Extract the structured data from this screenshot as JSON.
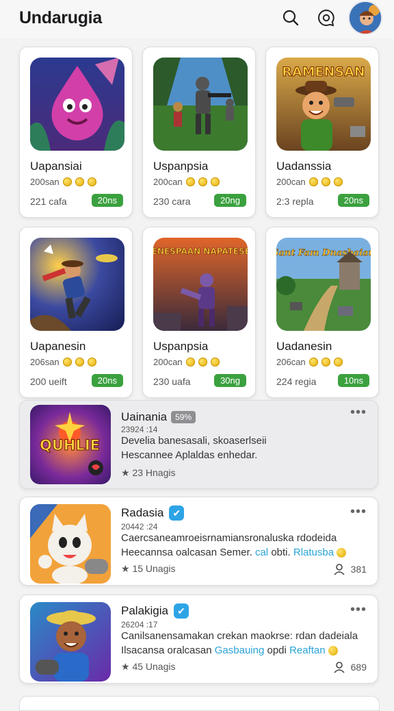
{
  "app": {
    "title": "Undarugia"
  },
  "cards": [
    {
      "title": "Uapansiai",
      "sub": "200san",
      "count": "221 cafa",
      "badge": "20ns",
      "art_text": ""
    },
    {
      "title": "Uspanpsia",
      "sub": "200can",
      "count": "230 cara",
      "badge": "20ng",
      "art_text": ""
    },
    {
      "title": "Uadanssia",
      "sub": "200can",
      "count": "2:3 repla",
      "badge": "20ns",
      "art_text": "RAMENSAN"
    },
    {
      "title": "Uapanesin",
      "sub": "206san",
      "count": "200 ueift",
      "badge": "20ns",
      "art_text": ""
    },
    {
      "title": "Uspanpsia",
      "sub": "200can",
      "count": "230 uafa",
      "badge": "30ng",
      "art_text": "GENESPAAN NAPATESEE"
    },
    {
      "title": "Uadanesin",
      "sub": "206can",
      "count": "224 regia",
      "badge": "10ns",
      "art_text": "Sant Fam Dnasbaian"
    }
  ],
  "posts": [
    {
      "title": "Uainania",
      "tag": "59%",
      "date": "23924 :14",
      "desc_line1": "Develia banesasali, skoaserlseii",
      "desc_line2": "Hescannee Aplaldas enhedar.",
      "stars": "23 Hnagis",
      "followers": "",
      "art_text": "QUHLIE"
    },
    {
      "title": "Radasia",
      "tag": "",
      "date": "20442 :24",
      "desc_line1": "Caercsaneamroeisrnamiansronaluska rdodeida",
      "desc_line2_pre": "Heecannsa oalcasan Semer.",
      "link1": "cal",
      "mid": "obti.",
      "link2": "Rlatusba",
      "stars": "15 Unagis",
      "followers": "381",
      "art_text": ""
    },
    {
      "title": "Palakigia",
      "tag": "",
      "date": "26204 :17",
      "desc_line1": "Canilsanensamakan crekan maokrse: rdan dadeiala",
      "desc_line2_pre": "Ilsacansa oralcasan",
      "link1": "Gasbauing",
      "mid": "opdi",
      "link2": "Reaftan",
      "stars": "45 Unagis",
      "followers": "689",
      "art_text": ""
    }
  ]
}
